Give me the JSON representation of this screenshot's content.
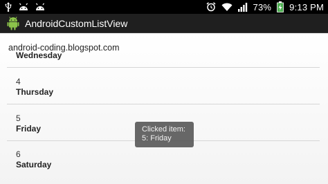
{
  "status_bar": {
    "icons_left": [
      "usb-icon",
      "android-face-icon",
      "android-face-icon"
    ],
    "icons_right": [
      "alarm-icon",
      "wifi-icon",
      "signal-icon",
      "battery-charging-icon",
      "clock-icon"
    ],
    "battery_percent": "73%",
    "time": "9:13",
    "time_suffix": "PM"
  },
  "action_bar": {
    "title": "AndroidCustomListView",
    "icon": "android-robot-icon"
  },
  "content": {
    "header": "android-coding.blogspot.com",
    "items": [
      {
        "number": "",
        "day": "Wednesday"
      },
      {
        "number": "4",
        "day": "Thursday"
      },
      {
        "number": "5",
        "day": "Friday"
      },
      {
        "number": "6",
        "day": "Saturday"
      }
    ]
  },
  "toast": {
    "line1": "Clicked item:",
    "line2": "5: Friday"
  },
  "colors": {
    "status_bar_bg": "#000000",
    "action_bar_bg": "#1f1f1f",
    "battery_green": "#4caf50",
    "toast_bg": "#5a5a5a"
  }
}
